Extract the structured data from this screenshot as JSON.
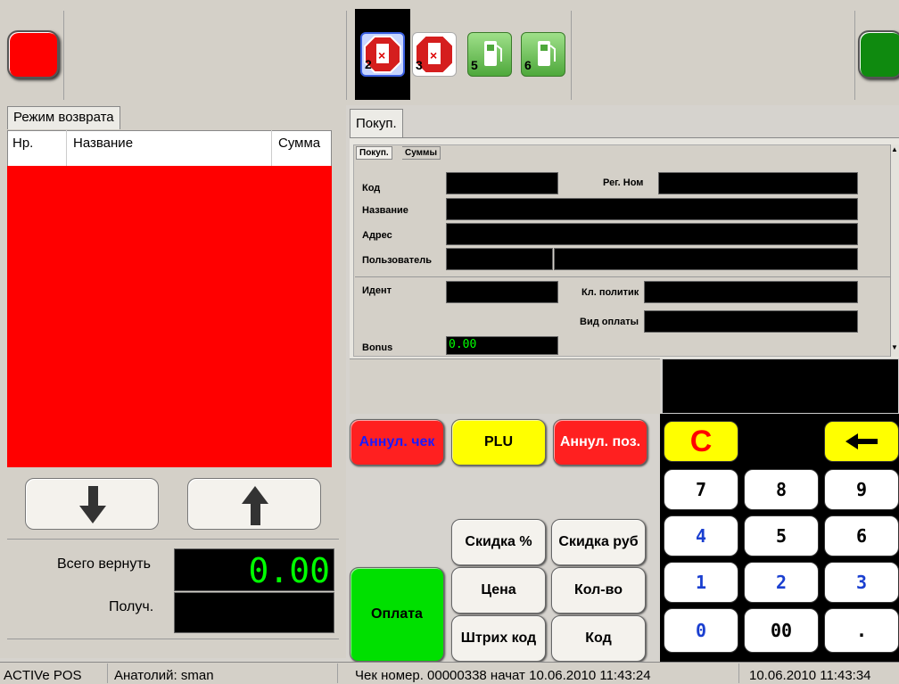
{
  "pumps": [
    {
      "num": "2",
      "state": "stopped-selected"
    },
    {
      "num": "3",
      "state": "stopped"
    },
    {
      "num": "5",
      "state": "ready"
    },
    {
      "num": "6",
      "state": "ready"
    }
  ],
  "left": {
    "tab": "Режим возврата",
    "columns": [
      "Нр.",
      "Название",
      "Сумма"
    ],
    "total_label": "Всего вернуть",
    "total_value": "0.00",
    "received_label": "Получ."
  },
  "right": {
    "tab": "Покуп.",
    "subtabs": [
      "Покуп.",
      "Суммы"
    ],
    "fields": {
      "code": "Код",
      "reg_num": "Рег. Ном",
      "name": "Название",
      "address": "Адрес",
      "user": "Пользователь",
      "ident": "Идент",
      "policy": "Кл. политик",
      "payment": "Вид оплаты",
      "bonus": "Bonus",
      "bonus_value": "0.00"
    }
  },
  "buttons": {
    "void_check": "Аннул. чек",
    "plu": "PLU",
    "void_pos": "Аннул. поз.",
    "discount_pct": "Скидка %",
    "discount_rub": "Скидка руб",
    "price": "Цена",
    "qty": "Кол-во",
    "barcode": "Штрих код",
    "code": "Код",
    "pay": "Оплата"
  },
  "keypad": {
    "clear": "C",
    "keys": [
      "7",
      "8",
      "9",
      "4",
      "5",
      "6",
      "1",
      "2",
      "3",
      "0",
      "00",
      "."
    ]
  },
  "status": {
    "app": "ACTIVe POS",
    "user": "Анатолий: sman",
    "check": "Чек номер. 00000338 начат 10.06.2010 11:43:24",
    "datetime": "10.06.2010 11:43:34"
  },
  "colors": {
    "red": "#ff0000",
    "green": "#0f8a0f",
    "yellow": "#ffff00",
    "digit_green": "#00ff00",
    "blue_digit": "#1a3fd0"
  }
}
